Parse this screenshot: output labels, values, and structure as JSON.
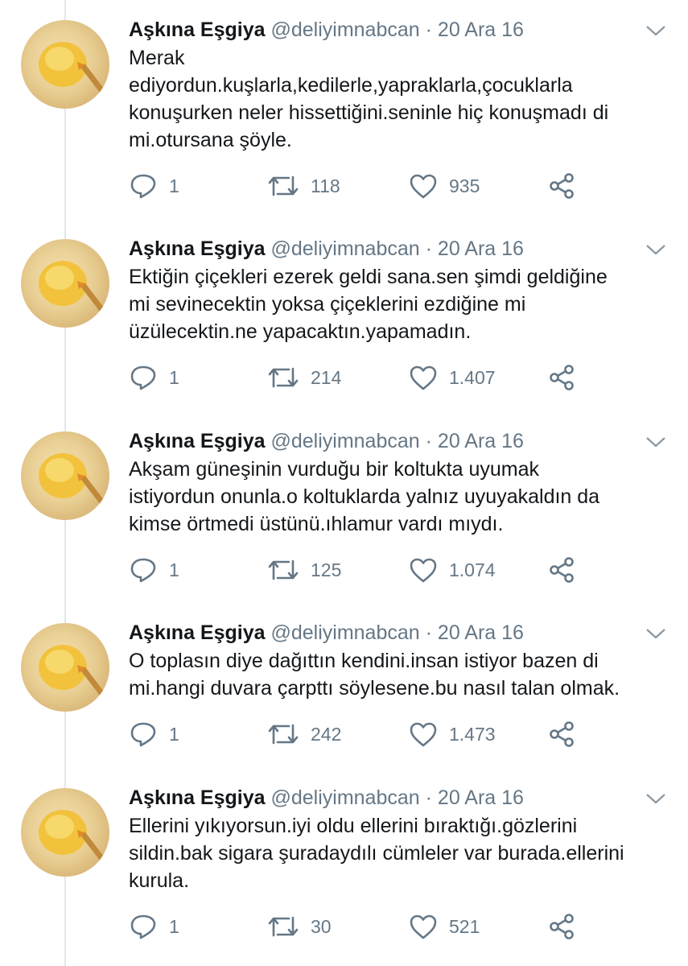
{
  "tweets": [
    {
      "name": "Aşkına Eşgiya",
      "handle": "@deliyimnabcan",
      "separator": "·",
      "date": "20 Ara 16",
      "lines": [
        "Merak",
        "ediyordun.kuşlarla,kedilerle,yapraklarla,çocuklarla",
        "konuşurken neler hissettiğini.seninle hiç konuşmadı di",
        "mi.otursana şöyle."
      ],
      "replies": "1",
      "retweets": "118",
      "likes": "935"
    },
    {
      "name": "Aşkına Eşgiya",
      "handle": "@deliyimnabcan",
      "separator": "·",
      "date": "20 Ara 16",
      "lines": [
        "Ektiğin çiçekleri ezerek geldi sana.sen şimdi geldiğine",
        "mi sevinecektin yoksa çiçeklerini ezdiğine mi",
        "üzülecektin.ne yapacaktın.yapamadın."
      ],
      "replies": "1",
      "retweets": "214",
      "likes": "1.407"
    },
    {
      "name": "Aşkına Eşgiya",
      "handle": "@deliyimnabcan",
      "separator": "·",
      "date": "20 Ara 16",
      "lines": [
        "Akşam güneşinin vurduğu bir koltukta uyumak",
        "istiyordun onunla.o koltuklarda yalnız uyuyakaldın da",
        "kimse örtmedi üstünü.ıhlamur vardı mıydı."
      ],
      "replies": "1",
      "retweets": "125",
      "likes": "1.074"
    },
    {
      "name": "Aşkına Eşgiya",
      "handle": "@deliyimnabcan",
      "separator": "·",
      "date": "20 Ara 16",
      "lines": [
        "O toplasın diye dağıttın kendini.insan istiyor bazen di",
        "mi.hangi duvara çarpttı söylesene.bu nasıl talan olmak."
      ],
      "replies": "1",
      "retweets": "242",
      "likes": "1.473"
    },
    {
      "name": "Aşkına Eşgiya",
      "handle": "@deliyimnabcan",
      "separator": "·",
      "date": "20 Ara 16",
      "lines": [
        "Ellerini yıkıyorsun.iyi oldu ellerini bıraktığı.gözlerini",
        "sildin.bak sigara şuradaydılı cümleler var burada.ellerini",
        "kurula."
      ],
      "replies": "1",
      "retweets": "30",
      "likes": "521"
    }
  ]
}
